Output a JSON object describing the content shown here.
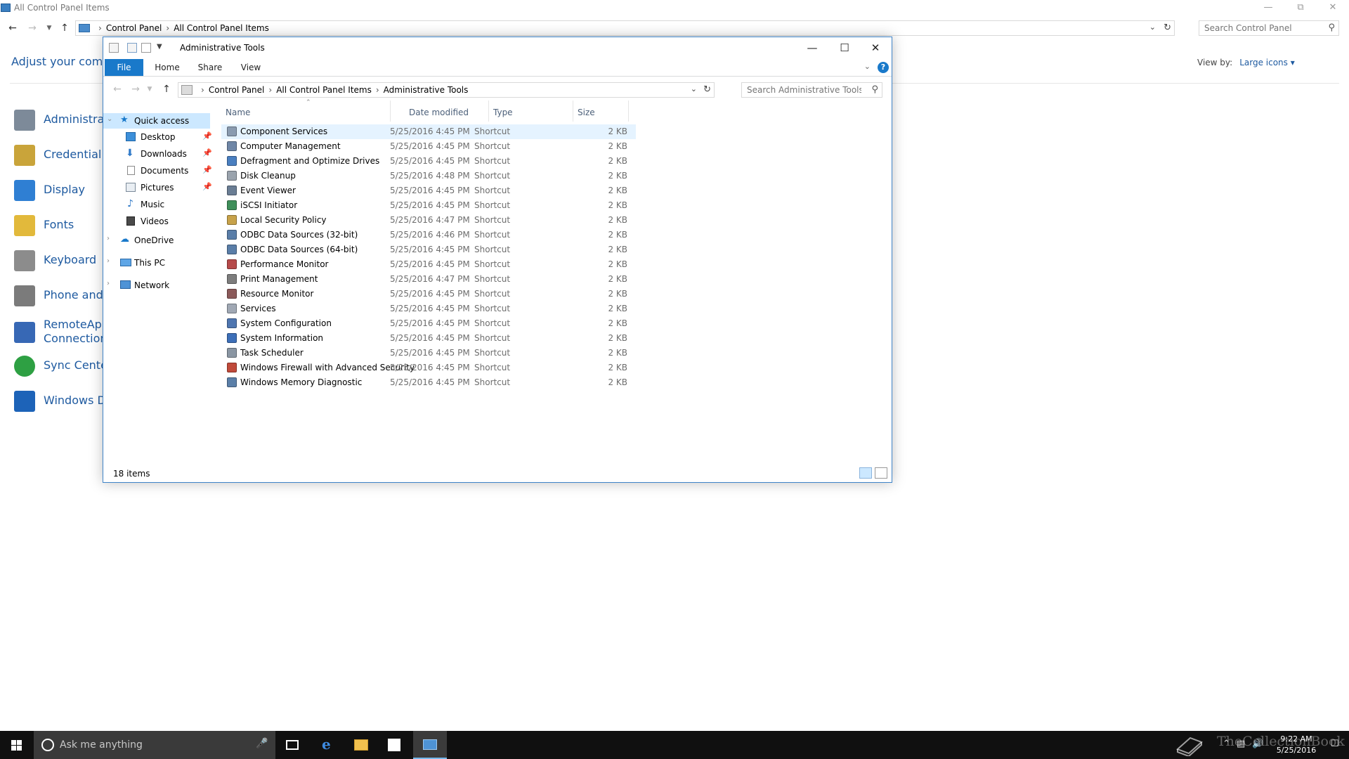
{
  "control_panel": {
    "window_title": "All Control Panel Items",
    "breadcrumb": [
      "Control Panel",
      "All Control Panel Items"
    ],
    "search_placeholder": "Search Control Panel",
    "heading": "Adjust your compu",
    "view_by_label": "View by:",
    "view_by_value": "Large icons ▾",
    "items": [
      {
        "label": "Administrati",
        "color": "#7d8a99"
      },
      {
        "label": "Credential M",
        "color": "#c9a43a"
      },
      {
        "label": "Display",
        "color": "#2f7fd3"
      },
      {
        "label": "Fonts",
        "color": "#e2b93b"
      },
      {
        "label": "Keyboard",
        "color": "#8c8c8c"
      },
      {
        "label": "Phone and M",
        "color": "#7b7b7b"
      },
      {
        "label": "RemoteApp",
        "label2": "Connections",
        "color": "#3768b5"
      },
      {
        "label": "Sync Center",
        "color": "#2ea043"
      },
      {
        "label": "Windows De",
        "color": "#1d63b8"
      }
    ]
  },
  "explorer": {
    "window_title": "Administrative Tools",
    "ribbon_tabs": [
      "File",
      "Home",
      "Share",
      "View"
    ],
    "breadcrumb": [
      "Control Panel",
      "All Control Panel Items",
      "Administrative Tools"
    ],
    "search_placeholder": "Search Administrative Tools",
    "nav_pane": {
      "quick_access": "Quick access",
      "quick_items": [
        "Desktop",
        "Downloads",
        "Documents",
        "Pictures",
        "Music",
        "Videos"
      ],
      "onedrive": "OneDrive",
      "this_pc": "This PC",
      "network": "Network"
    },
    "columns": {
      "name": "Name",
      "date": "Date modified",
      "type": "Type",
      "size": "Size"
    },
    "files": [
      {
        "name": "Component Services",
        "date": "5/25/2016 4:45 PM",
        "type": "Shortcut",
        "size": "2 KB",
        "color": "#8a9bb0"
      },
      {
        "name": "Computer Management",
        "date": "5/25/2016 4:45 PM",
        "type": "Shortcut",
        "size": "2 KB",
        "color": "#6f86a6"
      },
      {
        "name": "Defragment and Optimize Drives",
        "date": "5/25/2016 4:45 PM",
        "type": "Shortcut",
        "size": "2 KB",
        "color": "#4a7fc0"
      },
      {
        "name": "Disk Cleanup",
        "date": "5/25/2016 4:48 PM",
        "type": "Shortcut",
        "size": "2 KB",
        "color": "#9aa3ad"
      },
      {
        "name": "Event Viewer",
        "date": "5/25/2016 4:45 PM",
        "type": "Shortcut",
        "size": "2 KB",
        "color": "#6a7d94"
      },
      {
        "name": "iSCSI Initiator",
        "date": "5/25/2016 4:45 PM",
        "type": "Shortcut",
        "size": "2 KB",
        "color": "#3f8f5a"
      },
      {
        "name": "Local Security Policy",
        "date": "5/25/2016 4:47 PM",
        "type": "Shortcut",
        "size": "2 KB",
        "color": "#c7a24a"
      },
      {
        "name": "ODBC Data Sources (32-bit)",
        "date": "5/25/2016 4:46 PM",
        "type": "Shortcut",
        "size": "2 KB",
        "color": "#5a7ea8"
      },
      {
        "name": "ODBC Data Sources (64-bit)",
        "date": "5/25/2016 4:45 PM",
        "type": "Shortcut",
        "size": "2 KB",
        "color": "#5a7ea8"
      },
      {
        "name": "Performance Monitor",
        "date": "5/25/2016 4:45 PM",
        "type": "Shortcut",
        "size": "2 KB",
        "color": "#b64a4a"
      },
      {
        "name": "Print Management",
        "date": "5/25/2016 4:47 PM",
        "type": "Shortcut",
        "size": "2 KB",
        "color": "#7d7d7d"
      },
      {
        "name": "Resource Monitor",
        "date": "5/25/2016 4:45 PM",
        "type": "Shortcut",
        "size": "2 KB",
        "color": "#8b5a5a"
      },
      {
        "name": "Services",
        "date": "5/25/2016 4:45 PM",
        "type": "Shortcut",
        "size": "2 KB",
        "color": "#a0a8b4"
      },
      {
        "name": "System Configuration",
        "date": "5/25/2016 4:45 PM",
        "type": "Shortcut",
        "size": "2 KB",
        "color": "#4f76b0"
      },
      {
        "name": "System Information",
        "date": "5/25/2016 4:45 PM",
        "type": "Shortcut",
        "size": "2 KB",
        "color": "#3d6fb8"
      },
      {
        "name": "Task Scheduler",
        "date": "5/25/2016 4:45 PM",
        "type": "Shortcut",
        "size": "2 KB",
        "color": "#8a96a3"
      },
      {
        "name": "Windows Firewall with Advanced Security",
        "date": "5/25/2016 4:45 PM",
        "type": "Shortcut",
        "size": "2 KB",
        "color": "#c04a3a"
      },
      {
        "name": "Windows Memory Diagnostic",
        "date": "5/25/2016 4:45 PM",
        "type": "Shortcut",
        "size": "2 KB",
        "color": "#5b7fa8"
      }
    ],
    "item_count": "18 items"
  },
  "taskbar": {
    "search_text": "Ask me anything",
    "time": "9:22 AM",
    "date": "5/25/2016",
    "watermark": "TheCollectionBook"
  },
  "icons": {
    "start": "windows-logo-icon",
    "cortana": "cortana-ring-icon",
    "edge": "edge-icon",
    "explorer": "folder-icon",
    "store": "store-icon",
    "control_panel": "control-panel-icon"
  },
  "colors": {
    "accent": "#1979ca",
    "link": "#1e5aa0",
    "selection": "#cce8ff",
    "hover": "#e5f3ff",
    "taskbar": "#101010"
  }
}
